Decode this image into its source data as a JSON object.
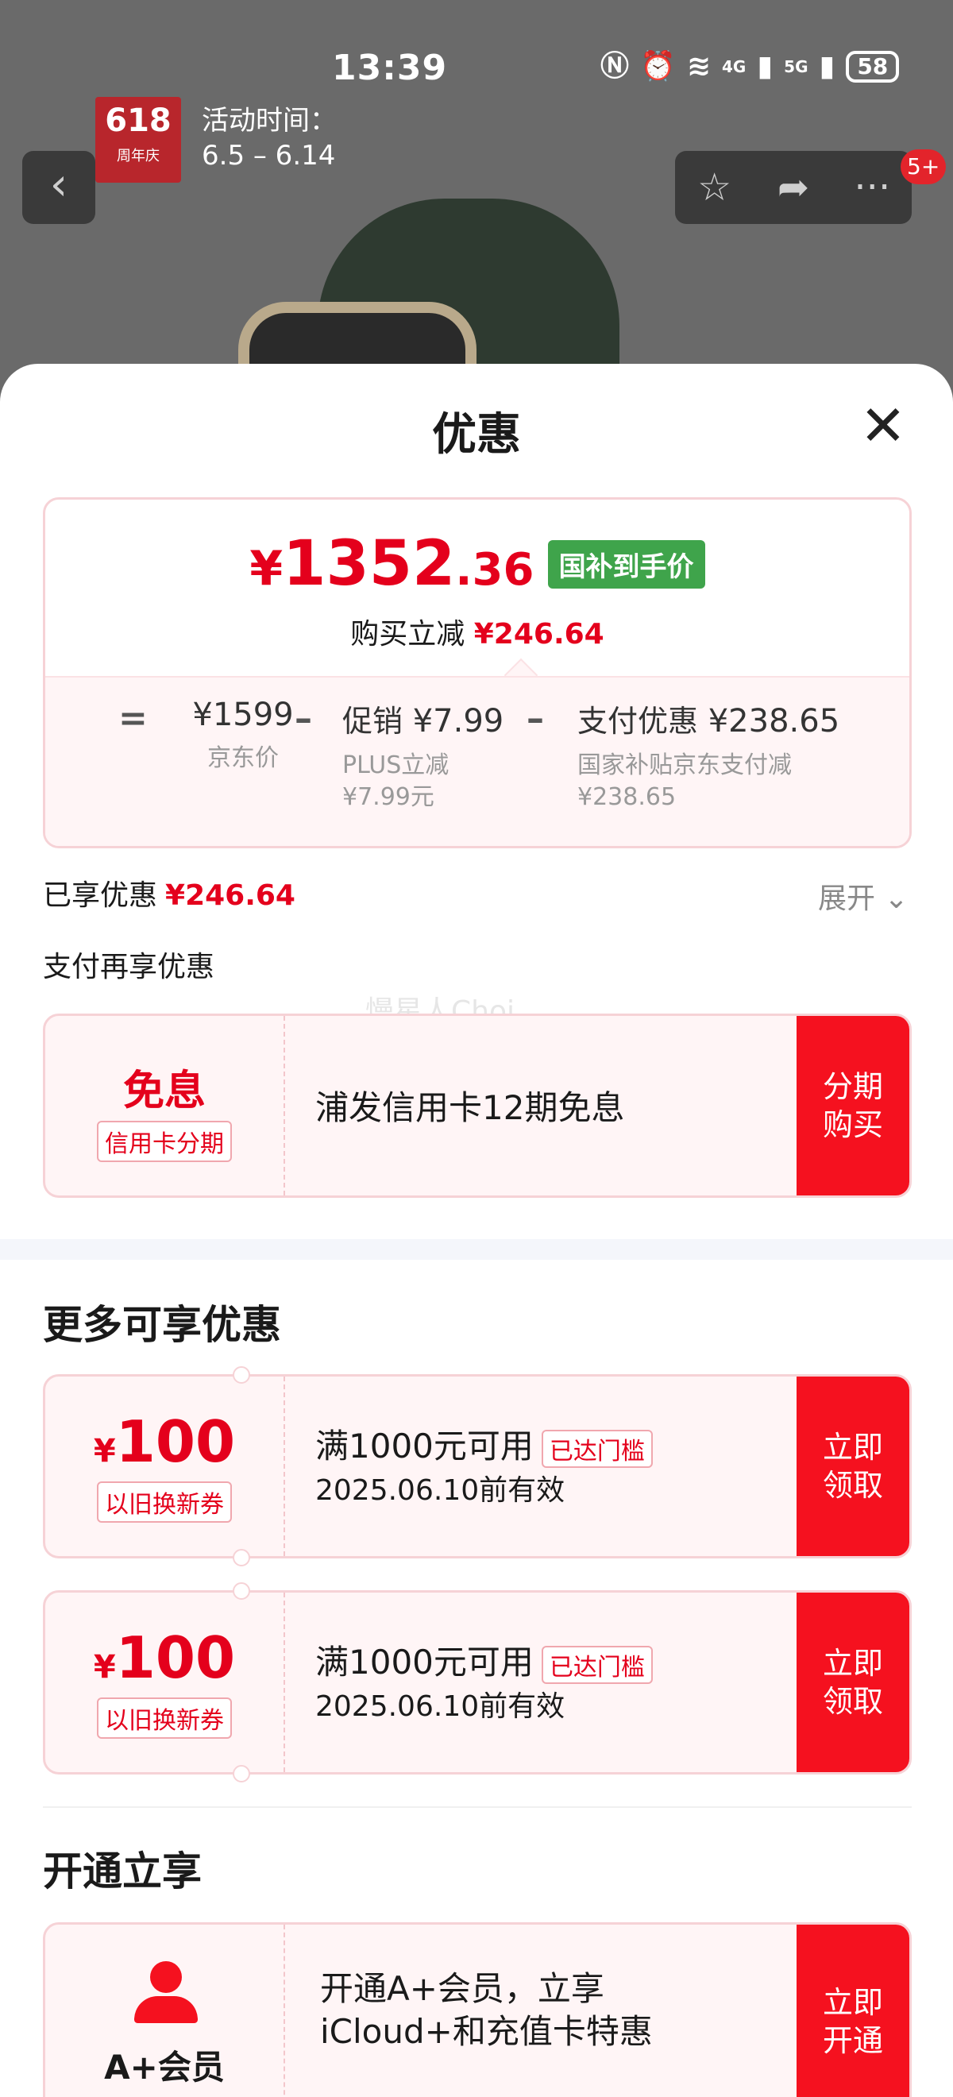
{
  "status_bar": {
    "time": "13:39",
    "battery": "58",
    "network1": "4G",
    "network2": "5G"
  },
  "background": {
    "badge_618": "618",
    "badge_sub": "周年庆",
    "activity_label": "活动时间：",
    "activity_dates": "6.5 – 6.14",
    "message_count": "5+"
  },
  "sheet": {
    "title": "优惠",
    "price": {
      "currency": "¥",
      "integer": "1352",
      "decimal": ".36",
      "tag": "国补到手价",
      "reduce_label": "购买立减",
      "reduce_value": "¥246.64"
    },
    "breakdown": {
      "equals": "=",
      "minus": "–",
      "jd_price": "¥1599",
      "jd_price_label": "京东价",
      "promo_label": "促销",
      "promo_value": "¥7.99",
      "promo_sub1": "PLUS立减",
      "promo_sub2": "¥7.99元",
      "pay_label": "支付优惠",
      "pay_value": "¥238.65",
      "pay_sub1": "国家补贴京东支付减",
      "pay_sub2": "¥238.65"
    },
    "enjoyed_label": "已享优惠",
    "enjoyed_value": "¥246.64",
    "expand_label": "展开",
    "pay_more_label": "支付再享优惠",
    "watermark": "慢星人Choi",
    "installment": {
      "main": "免息",
      "tag": "信用卡分期",
      "desc": "浦发信用卡12期免息",
      "action_line1": "分期",
      "action_line2": "购买"
    },
    "more_title": "更多可享优惠",
    "coupons": [
      {
        "currency": "¥",
        "amount": "100",
        "tag": "以旧换新券",
        "condition": "满1000元可用",
        "status": "已达门槛",
        "expiry": "2025.06.10前有效",
        "action_line1": "立即",
        "action_line2": "领取"
      },
      {
        "currency": "¥",
        "amount": "100",
        "tag": "以旧换新券",
        "condition": "满1000元可用",
        "status": "已达门槛",
        "expiry": "2025.06.10前有效",
        "action_line1": "立即",
        "action_line2": "领取"
      }
    ],
    "open_title": "开通立享",
    "member": {
      "label": "A+会员",
      "desc_line1": "开通A+会员，立享",
      "desc_line2": "iCloud+和充值卡特惠",
      "action_line1": "立即",
      "action_line2": "开通"
    }
  },
  "colors": {
    "accent_red": "#e4001c",
    "button_red": "#f5111f",
    "green_tag": "#3fa44b"
  }
}
